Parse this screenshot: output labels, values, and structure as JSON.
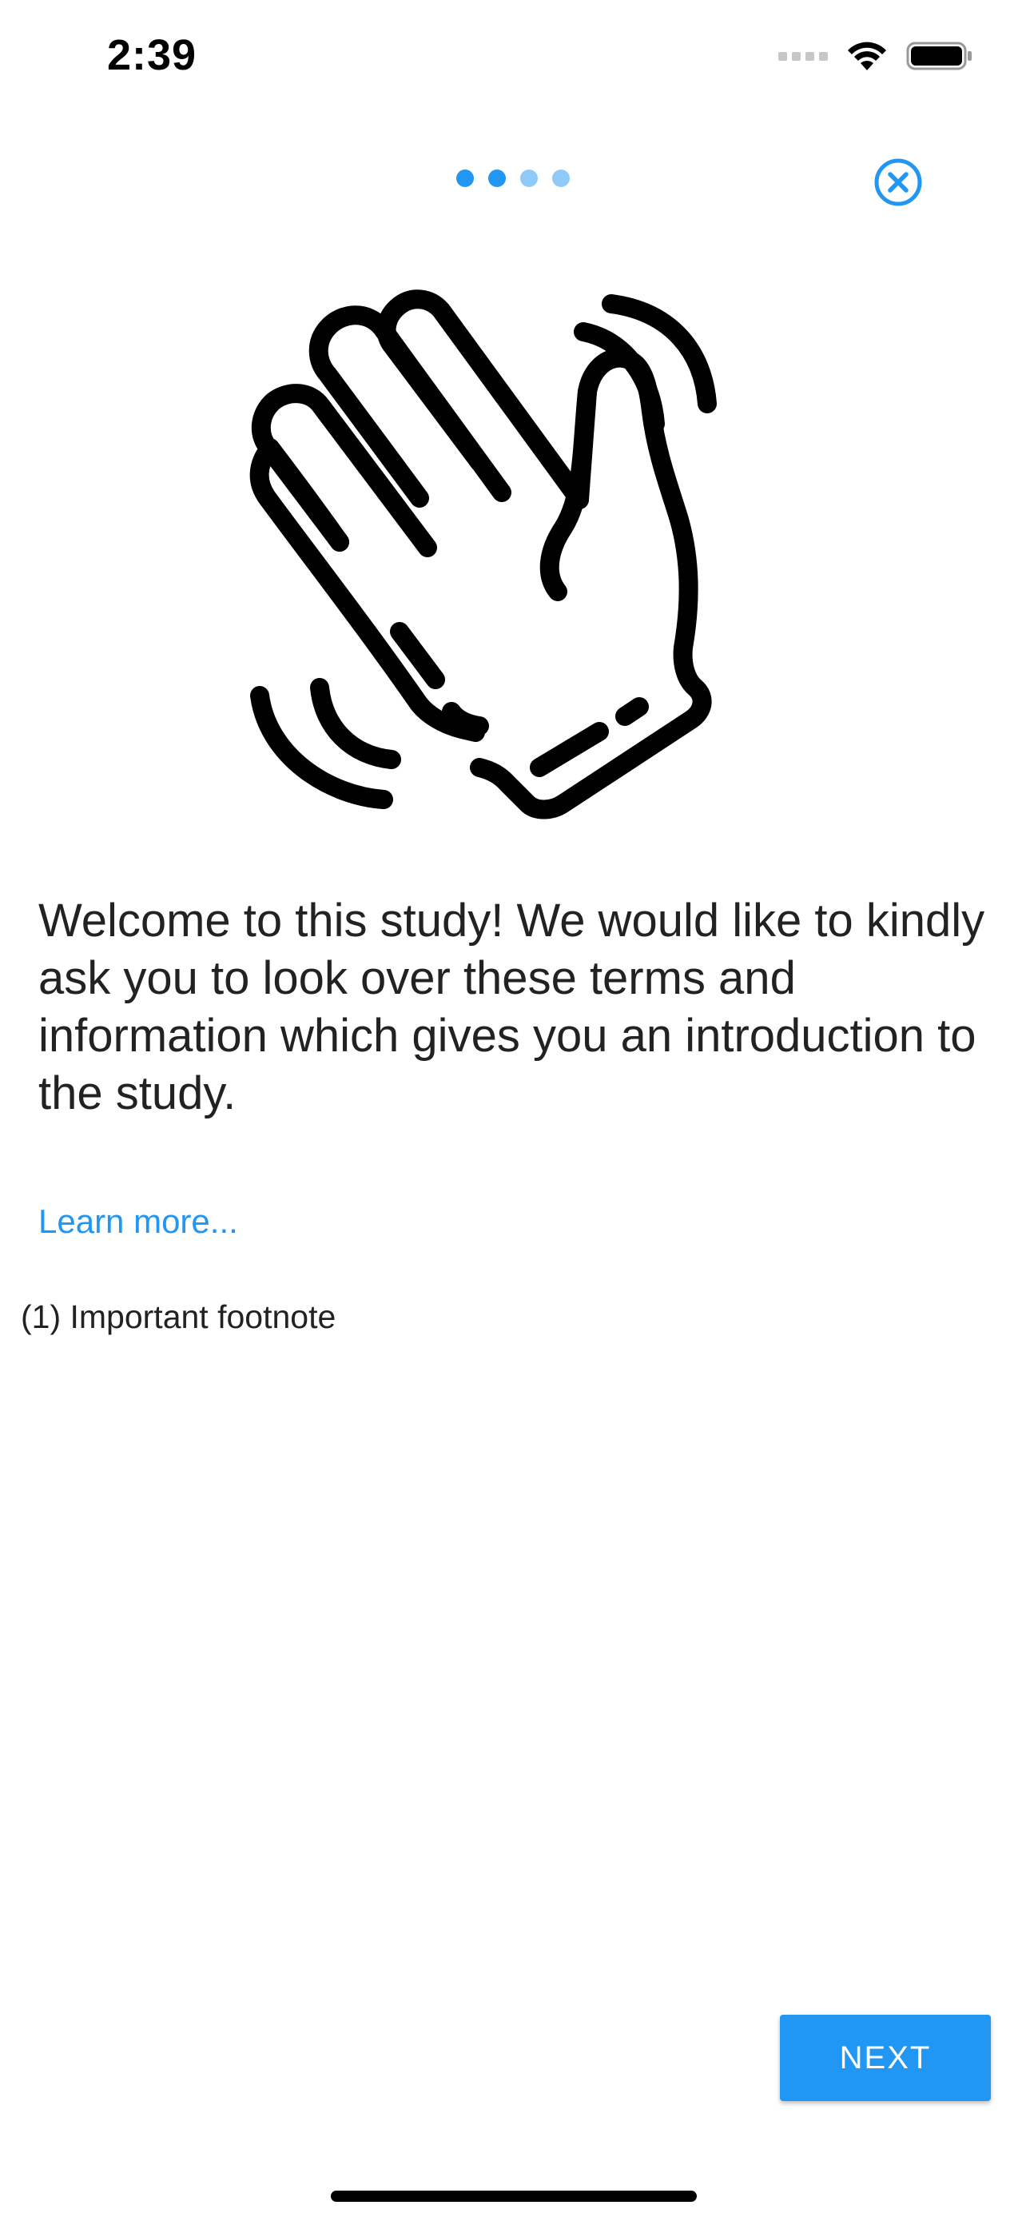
{
  "status_bar": {
    "time": "2:39",
    "icons": [
      "cellular-signal-icon",
      "wifi-icon",
      "battery-icon"
    ]
  },
  "pager": {
    "total": 4,
    "active_count": 2,
    "active_color": "#2196f3",
    "inactive_color": "#90caf9"
  },
  "close_icon": "close-circle-icon",
  "illustration_icon": "waving-hand-icon",
  "content": {
    "welcome_text": "Welcome to this study! We would like to kindly ask you to look over these terms and information which gives you an introduction to the study.",
    "learn_more": "Learn more...",
    "footnote": "(1) Important footnote"
  },
  "footer": {
    "next_label": "NEXT"
  },
  "colors": {
    "accent": "#2196f3",
    "text": "#222222",
    "background": "#ffffff"
  }
}
